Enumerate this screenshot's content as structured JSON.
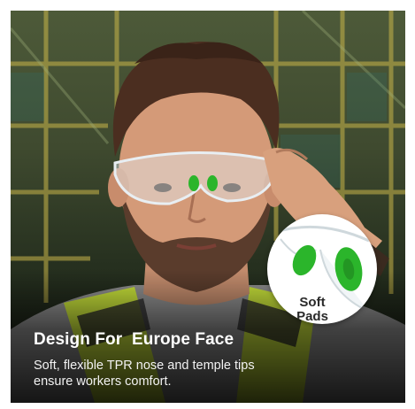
{
  "headline": "Design For  Europe Face",
  "subtext_line1": "Soft, flexible TPR nose and temple tips",
  "subtext_line2": "ensure workers comfort.",
  "badge_line1": "Soft",
  "badge_line2": "Pads",
  "colors": {
    "pad_green": "#2bb52b",
    "caption_text": "#ffffff",
    "badge_text": "#2a2a2a"
  }
}
